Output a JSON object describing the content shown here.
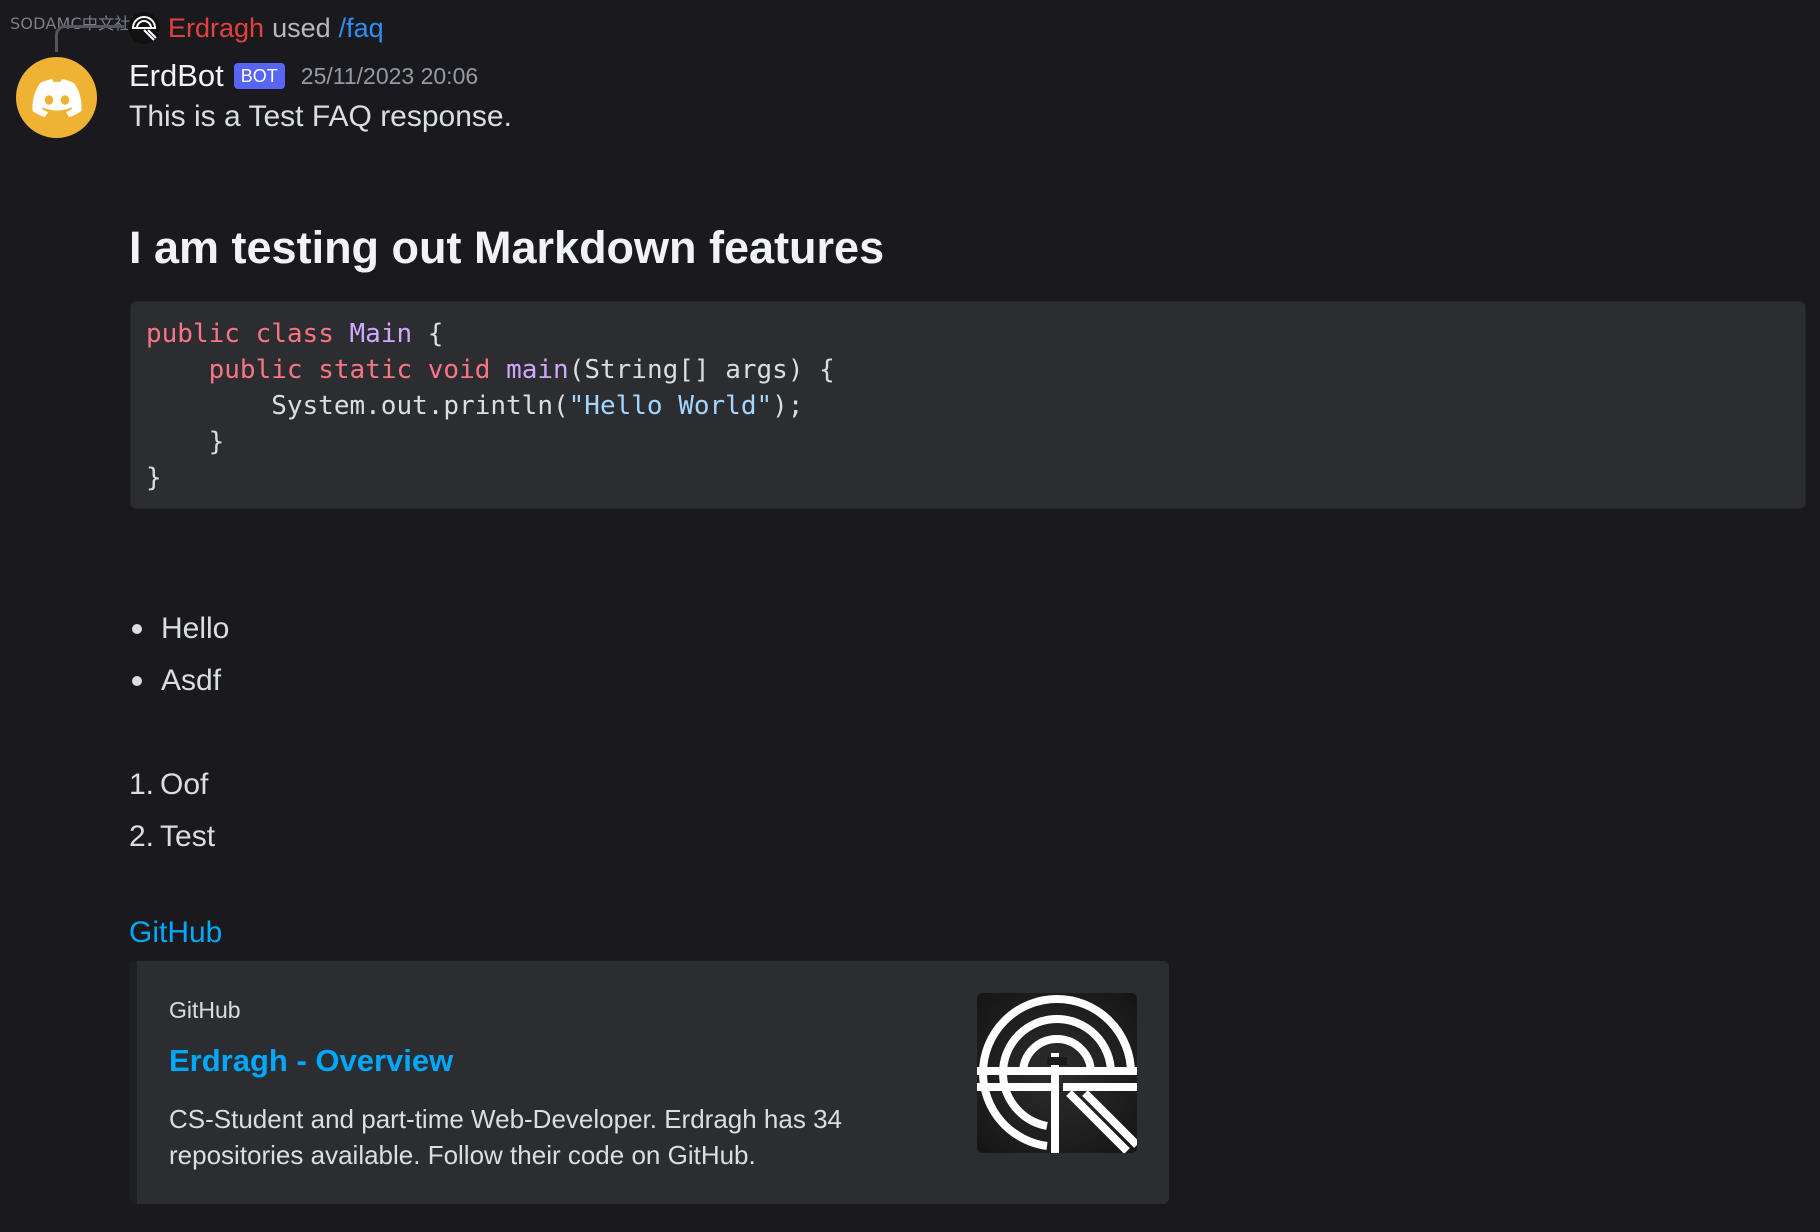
{
  "watermark": "SODAMC中文社区",
  "reply": {
    "user": "Erdragh",
    "used": "used",
    "command": "/faq"
  },
  "message": {
    "username": "ErdBot",
    "badge": "BOT",
    "timestamp": "25/11/2023 20:06",
    "text": "This is a Test FAQ response.",
    "heading": "I am testing out Markdown features",
    "code_lines": [
      "public class Main {",
      "    public static void main(String[] args) {",
      "        System.out.println(\"Hello World\");",
      "    }",
      "}"
    ],
    "bullets": [
      "Hello",
      "Asdf"
    ],
    "numbered": [
      {
        "num": "1.",
        "text": "Oof"
      },
      {
        "num": "2.",
        "text": "Test"
      }
    ],
    "link": "GitHub"
  },
  "embed": {
    "provider": "GitHub",
    "title": "Erdragh - Overview",
    "description": "CS-Student and part-time Web-Developer. Erdragh has 34 repositories available. Follow their code on GitHub."
  },
  "colors": {
    "background": "#1a1a1e",
    "reply_user": "#e4413c",
    "link": "#00a8fc",
    "bot_badge": "#5865f2",
    "avatar": "#f0b232",
    "code_keyword": "#f97583",
    "code_function": "#d2a8ff",
    "code_string": "#a5d6ff"
  },
  "icons": {
    "reply_avatar": "erdragh-logo-icon",
    "bot_avatar": "discord-logo-icon",
    "embed_thumbnail": "erdragh-logo-icon"
  }
}
